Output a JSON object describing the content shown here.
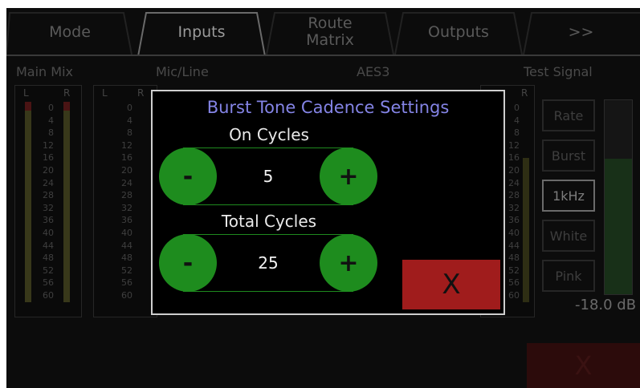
{
  "tabs": [
    {
      "label": "Mode"
    },
    {
      "label": "Inputs"
    },
    {
      "label": "Route Matrix"
    },
    {
      "label": "Outputs"
    },
    {
      "label": ">>"
    }
  ],
  "sections": {
    "main_mix": "Main Mix",
    "mic_line": "Mic/Line",
    "aes3": "AES3",
    "test_signal": "Test Signal"
  },
  "meter": {
    "left": "L",
    "right": "R",
    "scale": [
      "0",
      "4",
      "8",
      "12",
      "16",
      "20",
      "24",
      "28",
      "32",
      "36",
      "40",
      "44",
      "48",
      "52",
      "56",
      "60"
    ],
    "scale_partial": [
      "0",
      "4",
      "8",
      "12",
      "16",
      "20",
      "24",
      "28",
      "32",
      "36",
      "40",
      "44",
      "48",
      "52",
      "56",
      "60"
    ]
  },
  "test_signal": {
    "buttons": [
      "Rate",
      "Burst",
      "1kHz",
      "White",
      "Pink"
    ],
    "selected": "1kHz",
    "level_readout": "-18.0 dB",
    "level_fraction": 0.7
  },
  "background_close_label": "X",
  "modal": {
    "title": "Burst Tone Cadence Settings",
    "on_cycles_label": "On Cycles",
    "on_cycles_value": "5",
    "total_cycles_label": "Total Cycles",
    "total_cycles_value": "25",
    "minus_label": "-",
    "plus_label": "+",
    "close_label": "X"
  },
  "colors": {
    "accent_green": "#1e8c1e",
    "close_red": "#a01c1c",
    "title_blue": "#8484e6"
  }
}
